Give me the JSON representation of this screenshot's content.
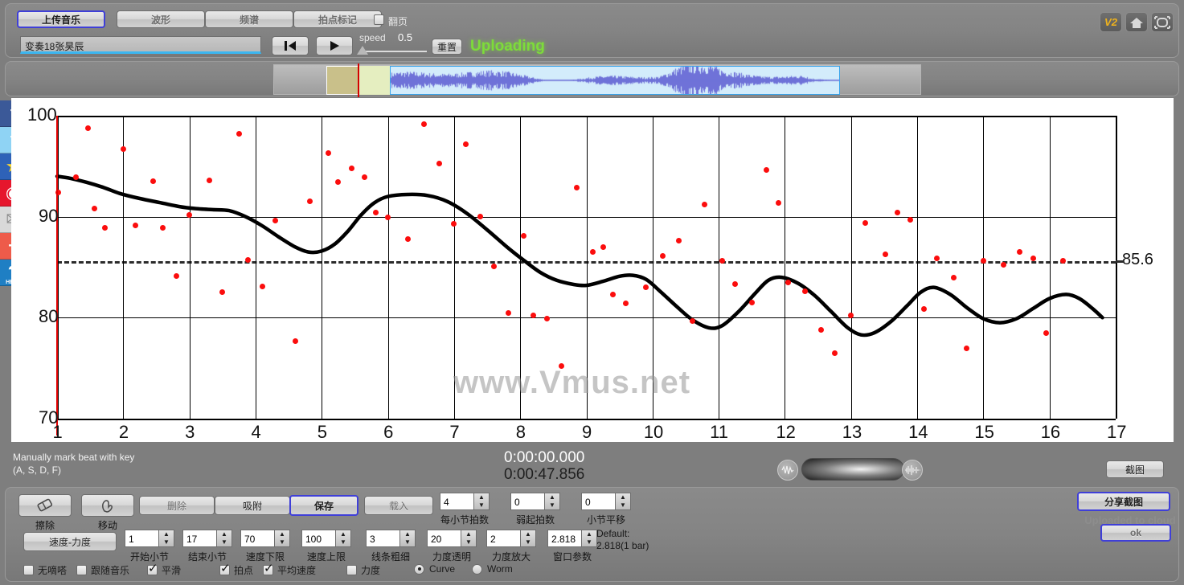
{
  "toolbar": {
    "tabs": [
      {
        "label": "上传音乐",
        "selected": true
      },
      {
        "label": "波形",
        "selected": false
      },
      {
        "label": "频谱",
        "selected": false
      },
      {
        "label": "拍点标记",
        "selected": false
      }
    ],
    "page_flip_label": "翻页",
    "page_flip_checked": false,
    "track_name": "变奏18张昊辰",
    "prev_icon": "skip-to-start-icon",
    "play_icon": "play-icon",
    "speed_label": "speed",
    "speed_value": "0.5",
    "reset_label": "重置",
    "upload_status": "Uploading",
    "icons": [
      {
        "name": "v2-badge-icon",
        "glyph": "V2"
      },
      {
        "name": "home-icon",
        "glyph": "⌂"
      },
      {
        "name": "fullscreen-icon",
        "glyph": "⛶"
      }
    ]
  },
  "social": [
    {
      "name": "facebook-icon",
      "glyph": "f",
      "bg": "#3b5998",
      "fg": "#ffffff"
    },
    {
      "name": "twitter-icon",
      "glyph": "t",
      "bg": "#8fd3f4",
      "fg": "#ffffff"
    },
    {
      "name": "kaixin-star-icon",
      "glyph": "★",
      "bg": "#2e62b8",
      "fg": "#ffd92e"
    },
    {
      "name": "weibo-icon",
      "glyph": "◉",
      "bg": "#e6162d",
      "fg": "#ffffff"
    },
    {
      "name": "email-icon",
      "glyph": "✉",
      "bg": "#d9d9d9",
      "fg": "#8a8a8a"
    },
    {
      "name": "add-share-icon",
      "glyph": "+",
      "bg": "#ee5b4a",
      "fg": "#ffffff"
    },
    {
      "name": "help-icon",
      "glyph": "?",
      "bg": "#1f7fc4",
      "fg": "#ffffff",
      "caption": "HELP"
    }
  ],
  "waveform": {
    "name": "waveform-overview",
    "selection_start_label": "",
    "playhead_color": "#d40000",
    "wave_color": "#6f72d8",
    "region_color": "#d3ecfb"
  },
  "chart_data": {
    "type": "line",
    "title": "",
    "xlabel": "",
    "ylabel": "",
    "xlim": [
      1,
      17
    ],
    "ylim": [
      70,
      100
    ],
    "xticks": [
      1,
      2,
      3,
      4,
      5,
      6,
      7,
      8,
      9,
      10,
      11,
      12,
      13,
      14,
      15,
      16,
      17
    ],
    "yticks": [
      70,
      80,
      90,
      100
    ],
    "grid": true,
    "legend": "none",
    "watermark": "www.Vmus.net",
    "reference_line": {
      "value": 85.6,
      "label": "85.6",
      "style": "dashed"
    },
    "series": [
      {
        "name": "smoothed-tempo-curve",
        "type": "line",
        "color": "#000000",
        "points": [
          [
            1.0,
            94.0
          ],
          [
            1.2,
            93.8
          ],
          [
            1.45,
            93.4
          ],
          [
            1.7,
            92.9
          ],
          [
            1.95,
            92.3
          ],
          [
            2.25,
            91.8
          ],
          [
            2.55,
            91.4
          ],
          [
            2.85,
            91.0
          ],
          [
            3.1,
            90.8
          ],
          [
            3.35,
            90.7
          ],
          [
            3.6,
            90.6
          ],
          [
            3.85,
            90.0
          ],
          [
            4.1,
            89.1
          ],
          [
            4.35,
            88.0
          ],
          [
            4.6,
            87.0
          ],
          [
            4.8,
            86.5
          ],
          [
            5.0,
            86.6
          ],
          [
            5.2,
            87.3
          ],
          [
            5.4,
            88.6
          ],
          [
            5.6,
            90.2
          ],
          [
            5.8,
            91.4
          ],
          [
            6.0,
            92.0
          ],
          [
            6.3,
            92.2
          ],
          [
            6.6,
            92.1
          ],
          [
            6.9,
            91.5
          ],
          [
            7.2,
            90.3
          ],
          [
            7.5,
            88.7
          ],
          [
            7.8,
            87.0
          ],
          [
            8.05,
            85.7
          ],
          [
            8.3,
            84.5
          ],
          [
            8.55,
            83.7
          ],
          [
            8.8,
            83.3
          ],
          [
            9.0,
            83.2
          ],
          [
            9.25,
            83.6
          ],
          [
            9.5,
            84.1
          ],
          [
            9.7,
            84.2
          ],
          [
            9.9,
            83.8
          ],
          [
            10.1,
            82.7
          ],
          [
            10.35,
            81.2
          ],
          [
            10.6,
            79.8
          ],
          [
            10.85,
            79.0
          ],
          [
            11.05,
            79.2
          ],
          [
            11.3,
            80.6
          ],
          [
            11.55,
            82.4
          ],
          [
            11.75,
            83.7
          ],
          [
            11.95,
            84.0
          ],
          [
            12.2,
            83.4
          ],
          [
            12.45,
            82.2
          ],
          [
            12.7,
            80.6
          ],
          [
            12.95,
            79.0
          ],
          [
            13.15,
            78.3
          ],
          [
            13.35,
            78.5
          ],
          [
            13.6,
            79.6
          ],
          [
            13.85,
            81.2
          ],
          [
            14.05,
            82.5
          ],
          [
            14.25,
            83.0
          ],
          [
            14.5,
            82.3
          ],
          [
            14.75,
            81.0
          ],
          [
            15.0,
            79.9
          ],
          [
            15.25,
            79.5
          ],
          [
            15.5,
            79.9
          ],
          [
            15.75,
            80.9
          ],
          [
            16.0,
            81.9
          ],
          [
            16.25,
            82.3
          ],
          [
            16.45,
            81.9
          ],
          [
            16.65,
            80.9
          ],
          [
            16.8,
            80.0
          ]
        ]
      },
      {
        "name": "beat-tempo-points",
        "type": "scatter",
        "color": "#fb0d0d",
        "points": [
          [
            1.02,
            92.4
          ],
          [
            1.28,
            93.9
          ],
          [
            1.47,
            98.8
          ],
          [
            1.56,
            90.8
          ],
          [
            1.72,
            88.9
          ],
          [
            2.0,
            96.7
          ],
          [
            2.18,
            89.1
          ],
          [
            2.45,
            93.5
          ],
          [
            2.6,
            88.9
          ],
          [
            2.8,
            84.1
          ],
          [
            3.0,
            90.2
          ],
          [
            3.3,
            93.6
          ],
          [
            3.5,
            82.5
          ],
          [
            3.75,
            98.2
          ],
          [
            3.88,
            85.7
          ],
          [
            4.1,
            83.1
          ],
          [
            4.3,
            89.6
          ],
          [
            4.6,
            77.7
          ],
          [
            4.82,
            91.5
          ],
          [
            5.1,
            96.3
          ],
          [
            5.25,
            93.4
          ],
          [
            5.45,
            94.8
          ],
          [
            5.65,
            93.9
          ],
          [
            5.82,
            90.4
          ],
          [
            6.0,
            89.9
          ],
          [
            6.3,
            87.8
          ],
          [
            6.55,
            99.2
          ],
          [
            6.78,
            95.3
          ],
          [
            7.0,
            89.3
          ],
          [
            7.18,
            97.2
          ],
          [
            7.4,
            90.0
          ],
          [
            7.6,
            85.1
          ],
          [
            7.82,
            80.5
          ],
          [
            8.05,
            88.1
          ],
          [
            8.2,
            80.2
          ],
          [
            8.4,
            79.9
          ],
          [
            8.62,
            75.2
          ],
          [
            8.85,
            92.9
          ],
          [
            9.1,
            86.5
          ],
          [
            9.25,
            87.0
          ],
          [
            9.4,
            82.3
          ],
          [
            9.6,
            81.4
          ],
          [
            9.9,
            83.0
          ],
          [
            10.15,
            86.1
          ],
          [
            10.4,
            87.6
          ],
          [
            10.6,
            79.7
          ],
          [
            10.78,
            91.2
          ],
          [
            11.05,
            85.6
          ],
          [
            11.25,
            83.3
          ],
          [
            11.5,
            81.5
          ],
          [
            11.72,
            94.6
          ],
          [
            11.9,
            91.4
          ],
          [
            12.05,
            83.5
          ],
          [
            12.3,
            82.6
          ],
          [
            12.55,
            78.8
          ],
          [
            12.75,
            76.5
          ],
          [
            13.0,
            80.2
          ],
          [
            13.22,
            89.4
          ],
          [
            13.52,
            86.3
          ],
          [
            13.7,
            90.4
          ],
          [
            13.9,
            89.7
          ],
          [
            14.1,
            80.9
          ],
          [
            14.3,
            85.9
          ],
          [
            14.55,
            84.0
          ],
          [
            14.75,
            77.0
          ],
          [
            15.0,
            85.6
          ],
          [
            15.3,
            85.2
          ],
          [
            15.55,
            86.5
          ],
          [
            15.75,
            85.9
          ],
          [
            15.95,
            78.5
          ],
          [
            16.2,
            85.6
          ]
        ]
      }
    ]
  },
  "status": {
    "hint_line1": "Manually mark beat with key",
    "hint_line2": "(A, S, D, F)",
    "time_current": "0:00:00.000",
    "time_total": "0:00:47.856",
    "volume_left_icon": "waveform-small-icon",
    "volume_right_icon": "waveform-dense-icon",
    "snapshot_label": "截图"
  },
  "bottom": {
    "tools": [
      {
        "name": "eraser-tool",
        "label": "",
        "caption": "擦除",
        "icon": "eraser-icon"
      },
      {
        "name": "move-tool",
        "label": "",
        "caption": "移动",
        "icon": "hand-move-icon"
      }
    ],
    "actions": [
      {
        "name": "delete-button",
        "label": "删除",
        "selected": false,
        "dim": true
      },
      {
        "name": "snap-button",
        "label": "吸附",
        "selected": false,
        "dim": false
      },
      {
        "name": "save-button",
        "label": "保存",
        "selected": true,
        "dim": false
      },
      {
        "name": "load-button",
        "label": "载入",
        "selected": false,
        "dim": true
      }
    ],
    "mode_button": {
      "name": "speed-dynamics-button",
      "label": "速度-力度"
    },
    "spinners": [
      {
        "name": "start-bar-spinner",
        "value": "1",
        "caption": "开始小节"
      },
      {
        "name": "end-bar-spinner",
        "value": "17",
        "caption": "结束小节"
      },
      {
        "name": "tempo-min-spinner",
        "value": "70",
        "caption": "速度下限"
      },
      {
        "name": "tempo-max-spinner",
        "value": "100",
        "caption": "速度上限"
      },
      {
        "name": "line-width-spinner",
        "value": "3",
        "caption": "线条粗细"
      },
      {
        "name": "dynamics-alpha-spinner",
        "value": "20",
        "caption": "力度透明"
      },
      {
        "name": "dynamics-scale-spinner",
        "value": "2",
        "caption": "力度放大"
      },
      {
        "name": "window-param-spinner",
        "value": "2.818",
        "caption": "窗口参数"
      }
    ],
    "spinners_row1": [
      {
        "name": "beats-per-bar-spinner",
        "value": "4",
        "caption": "每小节拍数"
      },
      {
        "name": "pickup-beats-spinner",
        "value": "0",
        "caption": "弱起拍数"
      },
      {
        "name": "bar-shift-spinner",
        "value": "0",
        "caption": "小节平移"
      }
    ],
    "default_note_line1": "Default:",
    "default_note_line2": "2.818(1 bar)",
    "checkboxes": [
      {
        "name": "no-tick-checkbox",
        "label": "无嘀嗒",
        "checked": false
      },
      {
        "name": "follow-music-checkbox",
        "label": "跟随音乐",
        "checked": false
      },
      {
        "name": "smooth-checkbox",
        "label": "平滑",
        "checked": true
      },
      {
        "name": "beat-checkbox",
        "label": "拍点",
        "checked": true
      },
      {
        "name": "avg-tempo-checkbox",
        "label": "平均速度",
        "checked": true
      },
      {
        "name": "dynamics-checkbox",
        "label": "力度",
        "checked": false
      }
    ],
    "radios": [
      {
        "name": "curve-radio",
        "label": "Curve",
        "selected": true
      },
      {
        "name": "worm-radio",
        "label": "Worm",
        "selected": false
      }
    ],
    "share_label": "分享截图",
    "cloud_message": "Uploaded to cloud",
    "cloud_button_label": "ok"
  }
}
